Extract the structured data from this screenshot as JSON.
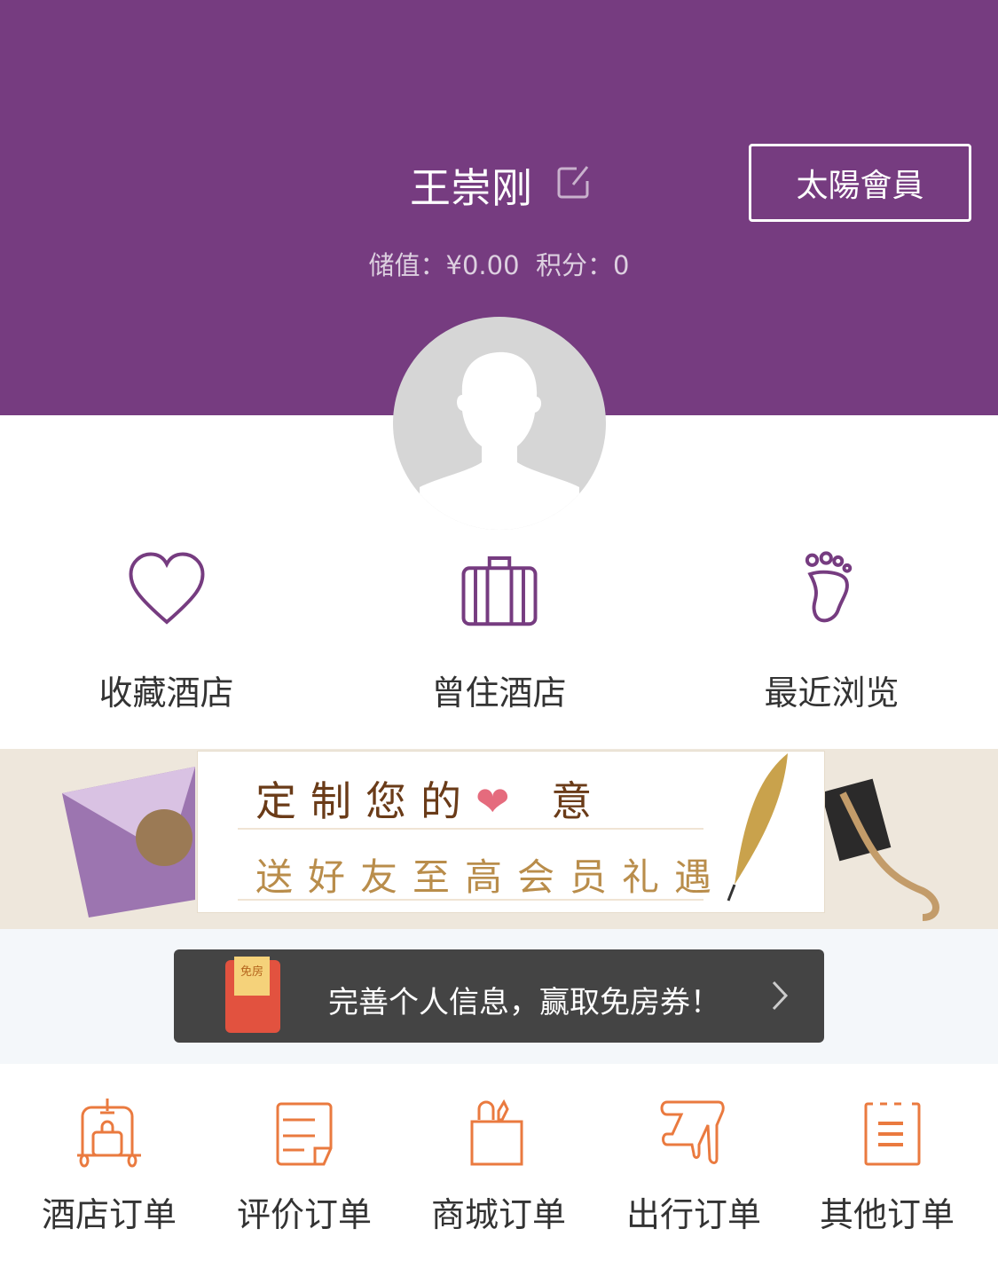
{
  "header": {
    "name": "王崇刚",
    "member_button": "太陽會員",
    "balance_label": "储值：",
    "balance_value": "¥0.00",
    "points_label": "积分：",
    "points_value": "0",
    "bg_color": "#763c80"
  },
  "quick_links": [
    {
      "label": "收藏酒店",
      "icon": "heart-icon"
    },
    {
      "label": "曾住酒店",
      "icon": "suitcase-icon"
    },
    {
      "label": "最近浏览",
      "icon": "footprint-icon"
    }
  ],
  "banner": {
    "line1": "定制您的",
    "line1_end": "意",
    "line2": "送好友至高会员礼遇"
  },
  "promo": {
    "text": "完善个人信息，赢取免房券！",
    "ticket_text": "免房"
  },
  "orders": [
    {
      "label": "酒店订单",
      "icon": "luggage-cart-icon"
    },
    {
      "label": "评价订单",
      "icon": "document-icon"
    },
    {
      "label": "商城订单",
      "icon": "shopping-bag-icon"
    },
    {
      "label": "出行订单",
      "icon": "airplane-icon"
    },
    {
      "label": "其他订单",
      "icon": "clipboard-icon"
    }
  ],
  "accent_color": "#ea7a3f"
}
